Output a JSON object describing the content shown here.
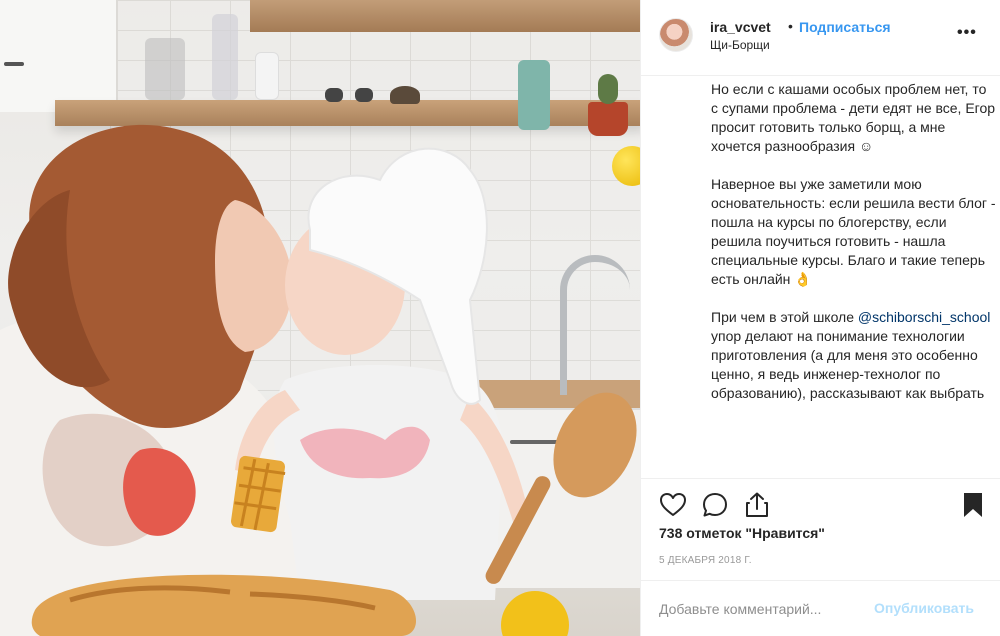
{
  "post": {
    "username": "ira_vcvet",
    "separator": "•",
    "follow_label": "Подписаться",
    "location": "Щи-Борщи",
    "more_icon": "more-options-icon",
    "more_glyph": "•••"
  },
  "caption": {
    "paragraph1": "Но если с кашами особых проблем нет, то с супами проблема - дети едят не все, Егор просит готовить только борщ, а мне хочется разнообразия ☺",
    "paragraph2": "Наверное вы уже заметили мою основательность: если решила вести блог - пошла на курсы по блогерству, если решила поучиться готовить - нашла специальные курсы. Благо и такие теперь есть онлайн 👌",
    "paragraph3_before": "При чем в этой школе ",
    "paragraph3_mention": "@schiborschi_school",
    "paragraph3_after": " упор делают на понимание технологии приготовления (а для меня это особенно ценно, я ведь инженер-технолог по образованию), рассказывают как выбрать"
  },
  "actions": {
    "like_icon": "heart-icon",
    "comment_icon": "comment-icon",
    "share_icon": "share-icon",
    "save_icon": "bookmark-icon"
  },
  "stats": {
    "likes_text": "738 отметок \"Нравится\"",
    "date_text": "5 ДЕКАБРЯ 2018 Г."
  },
  "comment": {
    "placeholder": "Добавьте комментарий...",
    "publish_label": "Опубликовать"
  },
  "colors": {
    "accent": "#3897f0",
    "publish_disabled": "#b2dffc",
    "text": "#262626",
    "muted": "#999999"
  }
}
